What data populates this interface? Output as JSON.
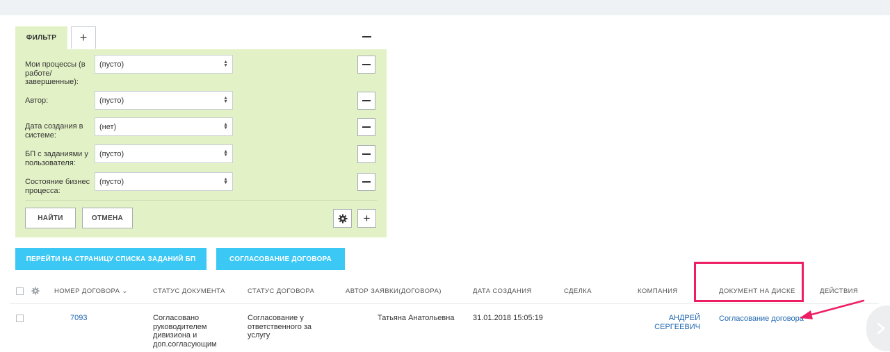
{
  "filter": {
    "tab_label": "ФИЛЬТР",
    "add_tab": "+",
    "fields": [
      {
        "label": "Мои процессы (в работе/ завершенные):",
        "value": "(пусто)"
      },
      {
        "label": "Автор:",
        "value": "(пусто)"
      },
      {
        "label": "Дата создания в системе:",
        "value": "(нет)"
      },
      {
        "label": "БП с заданиями у пользователя:",
        "value": "(пусто)"
      },
      {
        "label": "Состояние бизнес процесса:",
        "value": "(пусто)"
      }
    ],
    "find_label": "НАЙТИ",
    "cancel_label": "ОТМЕНА",
    "add_field": "+"
  },
  "actions": {
    "tasks_button": "ПЕРЕЙТИ НА СТРАНИЦУ СПИСКА ЗАДАНИЙ БП",
    "agreement_button": "СОГЛАСОВАНИЕ ДОГОВОРА"
  },
  "table": {
    "columns": [
      "НОМЕР ДОГОВОРА",
      "СТАТУС ДОКУМЕНТА",
      "СТАТУС ДОГОВОРА",
      "АВТОР ЗАЯВКИ(ДОГОВОРА)",
      "ДАТА СОЗДАНИЯ",
      "СДЕЛКА",
      "КОМПАНИЯ",
      "ДОКУМЕНТ НА ДИСКЕ",
      "ДЕЙСТВИЯ"
    ],
    "sort_indicator": "⌄",
    "rows": [
      {
        "number": "7093",
        "doc_status": "Согласовано руководителем дивизиона и доп.согласующим",
        "contract_status": "Согласование у ответственного за услугу",
        "author": "Татьяна Анатольевна",
        "created": "31.01.2018 15:05:19",
        "deal": "",
        "company": "АНДРЕЙ СЕРГЕЕВИЧ",
        "disk_document": "Согласование договора",
        "actions": ""
      }
    ]
  },
  "colors": {
    "accent": "#3bc8f5",
    "filter_bg": "#e3f2c6",
    "highlight": "#ee1e64",
    "link": "#2067b0"
  },
  "icons": [
    "gear-icon",
    "plus-icon",
    "minus-icon",
    "chevron-right-icon",
    "arrow-annotation-icon"
  ]
}
